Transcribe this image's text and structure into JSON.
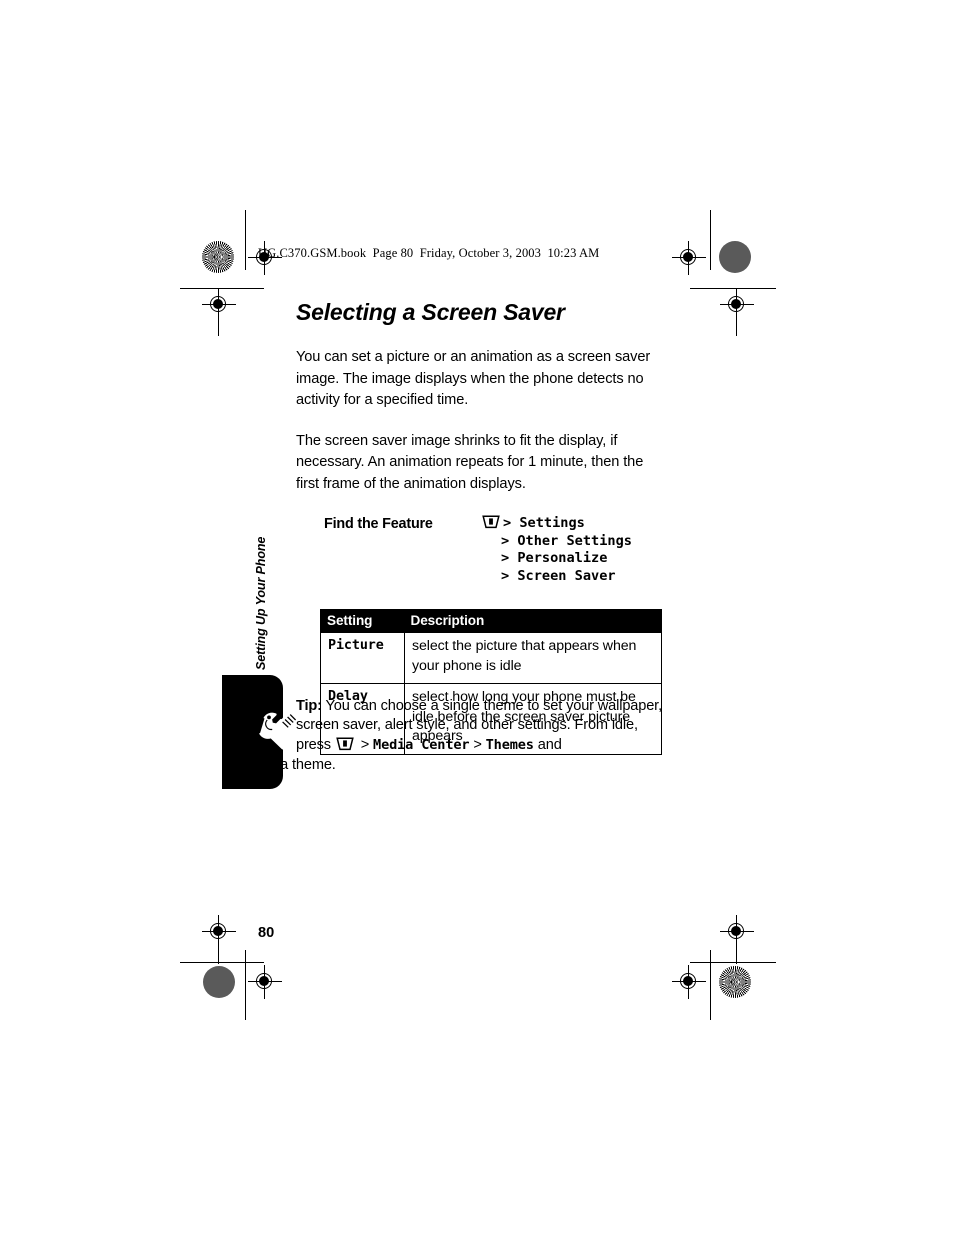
{
  "document": {
    "running_header": "UG.C370.GSM.book  Page 80  Friday, October 3, 2003  10:23 AM",
    "page_number": "80",
    "chapter_tab": "Setting Up Your Phone"
  },
  "main": {
    "title": "Selecting a Screen Saver",
    "paragraphs": [
      "You can set a picture or an animation as a screen saver image. The image displays when the phone detects no activity for a specified time.",
      "The screen saver image shrinks to fit the display, if necessary. An animation repeats for 1 minute, then the first frame of the animation displays."
    ],
    "find_the_feature": {
      "label": "Find the Feature",
      "menu_icon": "menu-key-icon",
      "steps": [
        "> Settings",
        "> Other Settings",
        "> Personalize",
        "> Screen Saver"
      ],
      "step_first": "> Settings",
      "step_second": "> Other Settings",
      "step_third": "> Personalize",
      "step_fourth": "> Screen Saver"
    },
    "settings_table": {
      "headers": [
        "Setting",
        "Description"
      ],
      "header_setting": "Setting",
      "header_description": "Description",
      "rows": [
        {
          "setting": "Picture",
          "description": "select the picture that appears when your phone is idle"
        },
        {
          "setting": "Delay",
          "description": "select how long your phone must be idle before the screen saver picture appears"
        }
      ]
    },
    "tip": {
      "icon": "wrench-screwdriver-icon",
      "lead": "Tip:",
      "text_part_1": " You can choose a single theme to set your wallpaper, screen saver, alert style, and other settings. From idle, press ",
      "menu_icon": "menu-key-icon",
      "gt_1": " > ",
      "path_1": "Media Center",
      "gt_2": " > ",
      "path_2": "Themes",
      "text_part_2": " and",
      "text_part_3": "select a theme."
    }
  }
}
